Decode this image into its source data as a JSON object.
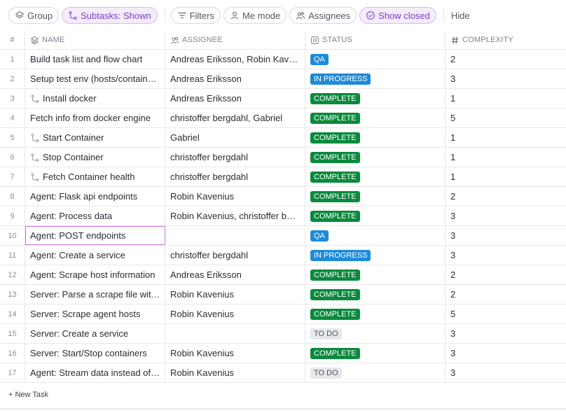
{
  "toolbar": {
    "group_label": "Group",
    "subtasks_label": "Subtasks: Shown",
    "filters_label": "Filters",
    "me_mode_label": "Me mode",
    "assignees_label": "Assignees",
    "show_closed_label": "Show closed",
    "hide_label": "Hide"
  },
  "columns": {
    "num": "#",
    "name": "NAME",
    "assignee": "ASSIGNEE",
    "status": "STATUS",
    "complexity": "COMPLEXITY"
  },
  "status_colors": {
    "QA": "#1f8ad6",
    "IN PROGRESS": "#1f8ad6",
    "COMPLETE": "#0a8a3c",
    "TO DO": "#e6e8eb"
  },
  "rows": [
    {
      "num": "1",
      "name": "Build task list and flow chart",
      "subtask": false,
      "assignee": "Andreas Eriksson, Robin Kav…",
      "status": "QA",
      "complexity": "2"
    },
    {
      "num": "2",
      "name": "Setup test env (hosts/contain…",
      "subtask": false,
      "assignee": "Andreas Eriksson",
      "status": "IN PROGRESS",
      "complexity": "3"
    },
    {
      "num": "3",
      "name": "Install docker",
      "subtask": true,
      "assignee": "Andreas Eriksson",
      "status": "COMPLETE",
      "complexity": "1"
    },
    {
      "num": "4",
      "name": "Fetch info from docker engine",
      "subtask": false,
      "assignee": "christoffer bergdahl, Gabriel",
      "status": "COMPLETE",
      "complexity": "5"
    },
    {
      "num": "5",
      "name": "Start Container",
      "subtask": true,
      "assignee": "Gabriel",
      "status": "COMPLETE",
      "complexity": "1"
    },
    {
      "num": "6",
      "name": "Stop Container",
      "subtask": true,
      "assignee": "christoffer bergdahl",
      "status": "COMPLETE",
      "complexity": "1"
    },
    {
      "num": "7",
      "name": "Fetch Container health",
      "subtask": true,
      "assignee": "christoffer bergdahl",
      "status": "COMPLETE",
      "complexity": "1"
    },
    {
      "num": "8",
      "name": "Agent: Flask api endpoints",
      "subtask": false,
      "assignee": "Robin Kavenius",
      "status": "COMPLETE",
      "complexity": "2"
    },
    {
      "num": "9",
      "name": "Agent: Process data",
      "subtask": false,
      "assignee": "Robin Kavenius, christoffer b…",
      "status": "COMPLETE",
      "complexity": "3"
    },
    {
      "num": "10",
      "name": "Agent: POST endpoints",
      "subtask": false,
      "assignee": "",
      "status": "QA",
      "complexity": "3",
      "selected": true
    },
    {
      "num": "11",
      "name": "Agent: Create a service",
      "subtask": false,
      "assignee": "christoffer bergdahl",
      "status": "IN PROGRESS",
      "complexity": "3"
    },
    {
      "num": "12",
      "name": "Agent: Scrape host information",
      "subtask": false,
      "assignee": "Andreas Eriksson",
      "status": "COMPLETE",
      "complexity": "2"
    },
    {
      "num": "13",
      "name": "Server: Parse a scrape file wit…",
      "subtask": false,
      "assignee": "Robin Kavenius",
      "status": "COMPLETE",
      "complexity": "2"
    },
    {
      "num": "14",
      "name": "Server: Scrape agent hosts",
      "subtask": false,
      "assignee": "Robin Kavenius",
      "status": "COMPLETE",
      "complexity": "5"
    },
    {
      "num": "15",
      "name": "Server: Create a service",
      "subtask": false,
      "assignee": "",
      "status": "TO DO",
      "complexity": "3"
    },
    {
      "num": "16",
      "name": "Server: Start/Stop containers",
      "subtask": false,
      "assignee": "Robin Kavenius",
      "status": "COMPLETE",
      "complexity": "3"
    },
    {
      "num": "17",
      "name": "Agent: Stream data instead of…",
      "subtask": false,
      "assignee": "Robin Kavenius",
      "status": "TO DO",
      "complexity": "3"
    }
  ],
  "footer": {
    "new_task_label": "+ New Task"
  }
}
